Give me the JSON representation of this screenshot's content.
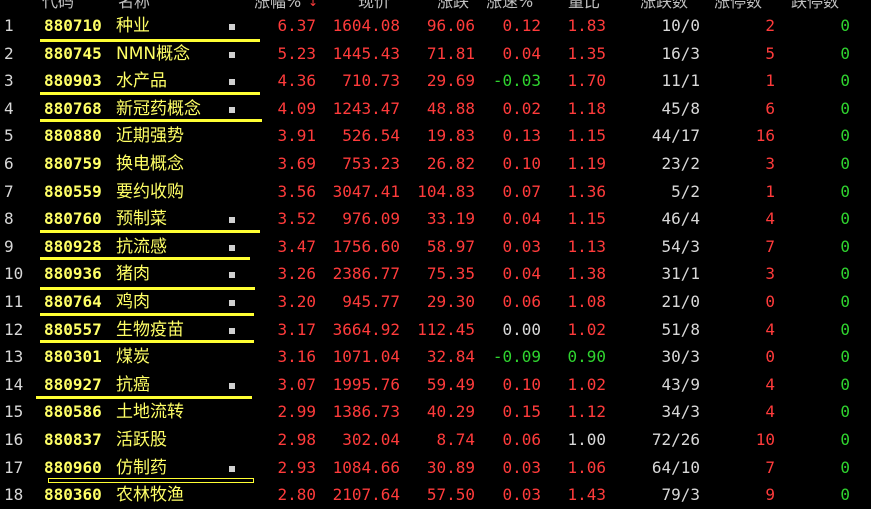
{
  "header": {
    "code": "代码",
    "name": "名称",
    "chg_pct": "涨幅%",
    "sort_arrow": "↓",
    "price": "现价",
    "chg_pts": "涨跌",
    "speed": "涨速%",
    "vol_ratio": "量比",
    "up_down": "涨跌数",
    "limit_up": "涨停数",
    "limit_down": "跌停数"
  },
  "rows": [
    {
      "idx": "1",
      "code": "880710",
      "name": "种业",
      "mark": true,
      "chg": "6.37",
      "price": "1604.08",
      "pts": "96.06",
      "spd": "0.12",
      "spd_c": "red",
      "vr": "1.83",
      "vr_c": "red",
      "ud": "10/0",
      "lu": "2",
      "ld": "0"
    },
    {
      "idx": "2",
      "code": "880745",
      "name": "NMN概念",
      "mark": true,
      "chg": "5.23",
      "price": "1445.43",
      "pts": "71.81",
      "spd": "0.04",
      "spd_c": "red",
      "vr": "1.35",
      "vr_c": "red",
      "ud": "16/3",
      "lu": "5",
      "ld": "0"
    },
    {
      "idx": "3",
      "code": "880903",
      "name": "水产品",
      "mark": true,
      "chg": "4.36",
      "price": "710.73",
      "pts": "29.69",
      "spd": "-0.03",
      "spd_c": "green",
      "vr": "1.70",
      "vr_c": "red",
      "ud": "11/1",
      "lu": "1",
      "ld": "0"
    },
    {
      "idx": "4",
      "code": "880768",
      "name": "新冠药概念",
      "mark": true,
      "chg": "4.09",
      "price": "1243.47",
      "pts": "48.88",
      "spd": "0.02",
      "spd_c": "red",
      "vr": "1.18",
      "vr_c": "red",
      "ud": "45/8",
      "lu": "6",
      "ld": "0"
    },
    {
      "idx": "5",
      "code": "880880",
      "name": "近期强势",
      "mark": false,
      "chg": "3.91",
      "price": "526.54",
      "pts": "19.83",
      "spd": "0.13",
      "spd_c": "red",
      "vr": "1.15",
      "vr_c": "red",
      "ud": "44/17",
      "lu": "16",
      "ld": "0"
    },
    {
      "idx": "6",
      "code": "880759",
      "name": "换电概念",
      "mark": false,
      "chg": "3.69",
      "price": "753.23",
      "pts": "26.82",
      "spd": "0.10",
      "spd_c": "red",
      "vr": "1.19",
      "vr_c": "red",
      "ud": "23/2",
      "lu": "3",
      "ld": "0"
    },
    {
      "idx": "7",
      "code": "880559",
      "name": "要约收购",
      "mark": false,
      "chg": "3.56",
      "price": "3047.41",
      "pts": "104.83",
      "spd": "0.07",
      "spd_c": "red",
      "vr": "1.36",
      "vr_c": "red",
      "ud": "5/2",
      "lu": "1",
      "ld": "0"
    },
    {
      "idx": "8",
      "code": "880760",
      "name": "预制菜",
      "mark": true,
      "chg": "3.52",
      "price": "976.09",
      "pts": "33.19",
      "spd": "0.04",
      "spd_c": "red",
      "vr": "1.15",
      "vr_c": "red",
      "ud": "46/4",
      "lu": "4",
      "ld": "0"
    },
    {
      "idx": "9",
      "code": "880928",
      "name": "抗流感",
      "mark": true,
      "chg": "3.47",
      "price": "1756.60",
      "pts": "58.97",
      "spd": "0.03",
      "spd_c": "red",
      "vr": "1.13",
      "vr_c": "red",
      "ud": "54/3",
      "lu": "7",
      "ld": "0"
    },
    {
      "idx": "10",
      "code": "880936",
      "name": "猪肉",
      "mark": true,
      "chg": "3.26",
      "price": "2386.77",
      "pts": "75.35",
      "spd": "0.04",
      "spd_c": "red",
      "vr": "1.38",
      "vr_c": "red",
      "ud": "31/1",
      "lu": "3",
      "ld": "0"
    },
    {
      "idx": "11",
      "code": "880764",
      "name": "鸡肉",
      "mark": true,
      "chg": "3.20",
      "price": "945.77",
      "pts": "29.30",
      "spd": "0.06",
      "spd_c": "red",
      "vr": "1.08",
      "vr_c": "red",
      "ud": "21/0",
      "lu": "0",
      "ld": "0"
    },
    {
      "idx": "12",
      "code": "880557",
      "name": "生物疫苗",
      "mark": true,
      "chg": "3.17",
      "price": "3664.92",
      "pts": "112.45",
      "spd": "0.00",
      "spd_c": "white",
      "vr": "1.02",
      "vr_c": "red",
      "ud": "51/8",
      "lu": "4",
      "ld": "0"
    },
    {
      "idx": "13",
      "code": "880301",
      "name": "煤炭",
      "mark": false,
      "chg": "3.16",
      "price": "1071.04",
      "pts": "32.84",
      "spd": "-0.09",
      "spd_c": "green",
      "vr": "0.90",
      "vr_c": "green",
      "ud": "30/3",
      "lu": "0",
      "ld": "0"
    },
    {
      "idx": "14",
      "code": "880927",
      "name": "抗癌",
      "mark": true,
      "chg": "3.07",
      "price": "1995.76",
      "pts": "59.49",
      "spd": "0.10",
      "spd_c": "red",
      "vr": "1.02",
      "vr_c": "red",
      "ud": "43/9",
      "lu": "4",
      "ld": "0"
    },
    {
      "idx": "15",
      "code": "880586",
      "name": "土地流转",
      "mark": false,
      "chg": "2.99",
      "price": "1386.73",
      "pts": "40.29",
      "spd": "0.15",
      "spd_c": "red",
      "vr": "1.12",
      "vr_c": "red",
      "ud": "34/3",
      "lu": "4",
      "ld": "0"
    },
    {
      "idx": "16",
      "code": "880837",
      "name": "活跃股",
      "mark": false,
      "chg": "2.98",
      "price": "302.04",
      "pts": "8.74",
      "spd": "0.06",
      "spd_c": "red",
      "vr": "1.00",
      "vr_c": "white",
      "ud": "72/26",
      "lu": "10",
      "ld": "0"
    },
    {
      "idx": "17",
      "code": "880960",
      "name": "仿制药",
      "mark": true,
      "chg": "2.93",
      "price": "1084.66",
      "pts": "30.89",
      "spd": "0.03",
      "spd_c": "red",
      "vr": "1.06",
      "vr_c": "red",
      "ud": "64/10",
      "lu": "7",
      "ld": "0"
    },
    {
      "idx": "18",
      "code": "880360",
      "name": "农林牧渔",
      "mark": false,
      "chg": "2.80",
      "price": "2107.64",
      "pts": "57.50",
      "spd": "0.03",
      "spd_c": "red",
      "vr": "1.43",
      "vr_c": "red",
      "ud": "79/3",
      "lu": "9",
      "ld": "0"
    }
  ],
  "colors": {
    "up": "#ff3b3b",
    "down": "#2fd32f",
    "flat": "#d8d8d8",
    "highlight": "#ffff33"
  }
}
